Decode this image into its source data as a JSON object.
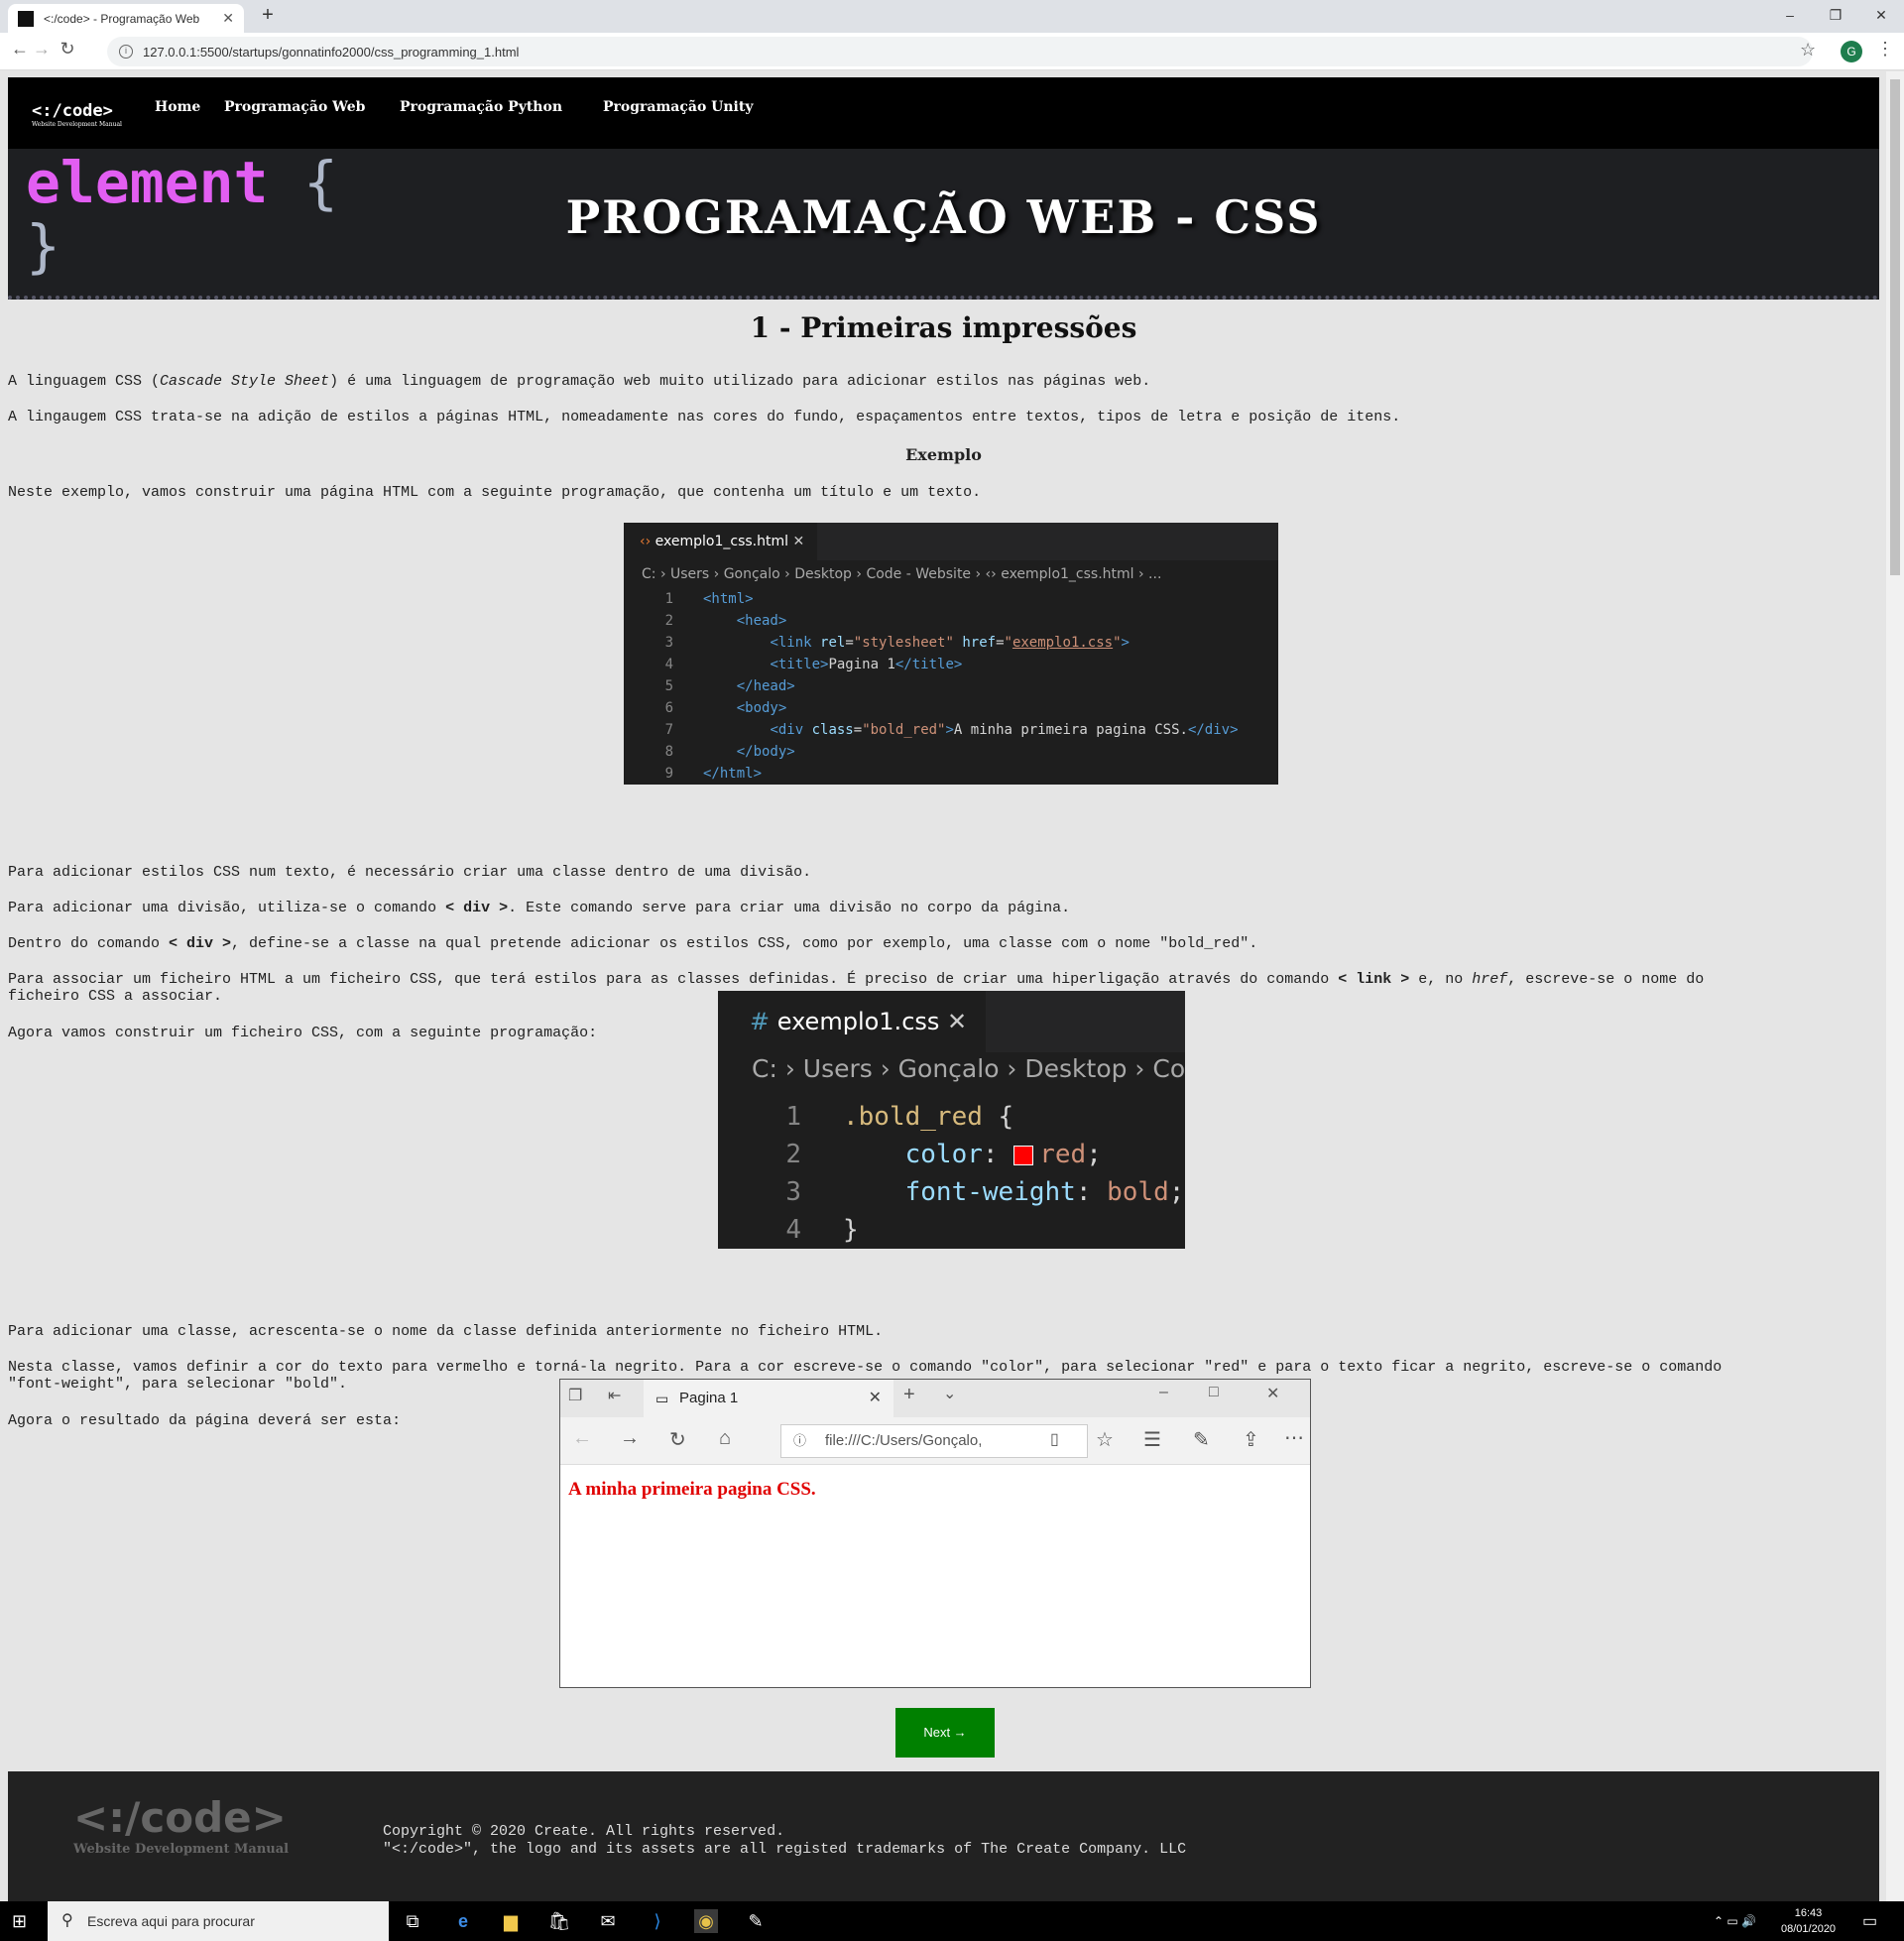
{
  "browser": {
    "tab_title": "<:/code> - Programação Web",
    "tab_close": "✕",
    "new_tab": "+",
    "url": "127.0.0.1:5500/startups/gonnatinfo2000/css_programming_1.html",
    "profile_initial": "G",
    "window_buttons": [
      "–",
      "❐",
      "✕"
    ]
  },
  "nav": {
    "logo_main": "<:/code>",
    "logo_sub": "Website Development Manual",
    "items": [
      "Home",
      "Programação Web",
      "Programação Python",
      "Programação Unity"
    ]
  },
  "hero": {
    "deco_line1": "element",
    "deco_brace_open": "{",
    "deco_brace_close": "}",
    "title": "PROGRAMAÇÃO WEB - CSS"
  },
  "content": {
    "heading": "1 - Primeiras impressões",
    "p1_a": "A linguagem CSS (",
    "p1_em": "Cascade Style Sheet",
    "p1_b": ") é uma linguagem de programação web muito utilizado para adicionar estilos nas páginas web.",
    "p2": "A lingaugem CSS trata-se na adição de estilos a páginas HTML, nomeadamente nas cores do fundo, espaçamentos entre textos, tipos de letra e posição de itens.",
    "example_heading": "Exemplo",
    "p3": "Neste exemplo, vamos construir uma página HTML com a seguinte programação, que contenha um título e um texto.",
    "p4": "Para adicionar estilos CSS num texto, é necessário criar uma classe dentro de uma divisão.",
    "p5_a": "Para adicionar uma divisão, utiliza-se o comando ",
    "p5_cmd": "< div >",
    "p5_b": ". Este comando serve para criar uma divisão no corpo da página.",
    "p6_a": "Dentro do comando ",
    "p6_cmd": "< div >",
    "p6_b": ", define-se a classe na qual pretende adicionar os estilos CSS, como por exemplo, uma classe com o nome \"bold_red\".",
    "p7_a": "Para associar um ficheiro HTML a um ficheiro CSS, que terá estilos para as classes definidas. É preciso de criar uma hiperligação através do comando ",
    "p7_cmd": "< link >",
    "p7_b": " e, no ",
    "p7_em": "href",
    "p7_c": ", escreve-se o nome do",
    "p7_d": "ficheiro CSS a associar.",
    "p8": "Agora vamos construir um ficheiro CSS, com a seguinte programação:",
    "p9": "Para adicionar uma classe, acrescenta-se o nome da classe definida anteriormente no ficheiro HTML.",
    "p10_a": "Nesta classe, vamos definir a cor do texto para vermelho e torná-la negrito. Para a cor escreve-se o comando \"color\", para selecionar \"red\" e para o texto ficar a negrito, escreve-se o comando",
    "p10_b": "\"font-weight\", para selecionar \"bold\".",
    "p11": "Agora o resultado da página deverá ser esta:",
    "next_button": "Next →"
  },
  "code_html": {
    "tab": "exemplo1_css.html",
    "breadcrumb": "C: › Users › Gonçalo › Desktop › Code - Website › ‹› exemplo1_css.html › ...",
    "line_numbers": [
      "1",
      "2",
      "3",
      "4",
      "5",
      "6",
      "7",
      "8",
      "9"
    ]
  },
  "code_css": {
    "tab": "exemplo1.css",
    "breadcrumb": "C: › Users › Gonçalo › Desktop › Cod",
    "line_numbers": [
      "1",
      "2",
      "3",
      "4"
    ]
  },
  "edge_window": {
    "tab_title": "Pagina 1",
    "address": "file:///C:/Users/Gonçalo,",
    "body_text": "A minha primeira pagina CSS."
  },
  "footer": {
    "logo_main": "<:/code>",
    "logo_sub": "Website Development Manual",
    "line1": "Copyright © 2020 Create. All rights reserved.",
    "line2": "\"<:/code>\", the logo and its assets are all registed trademarks of The Create Company. LLC"
  },
  "taskbar": {
    "search_placeholder": "Escreva aqui para procurar",
    "time": "16:43",
    "date": "08/01/2020"
  }
}
